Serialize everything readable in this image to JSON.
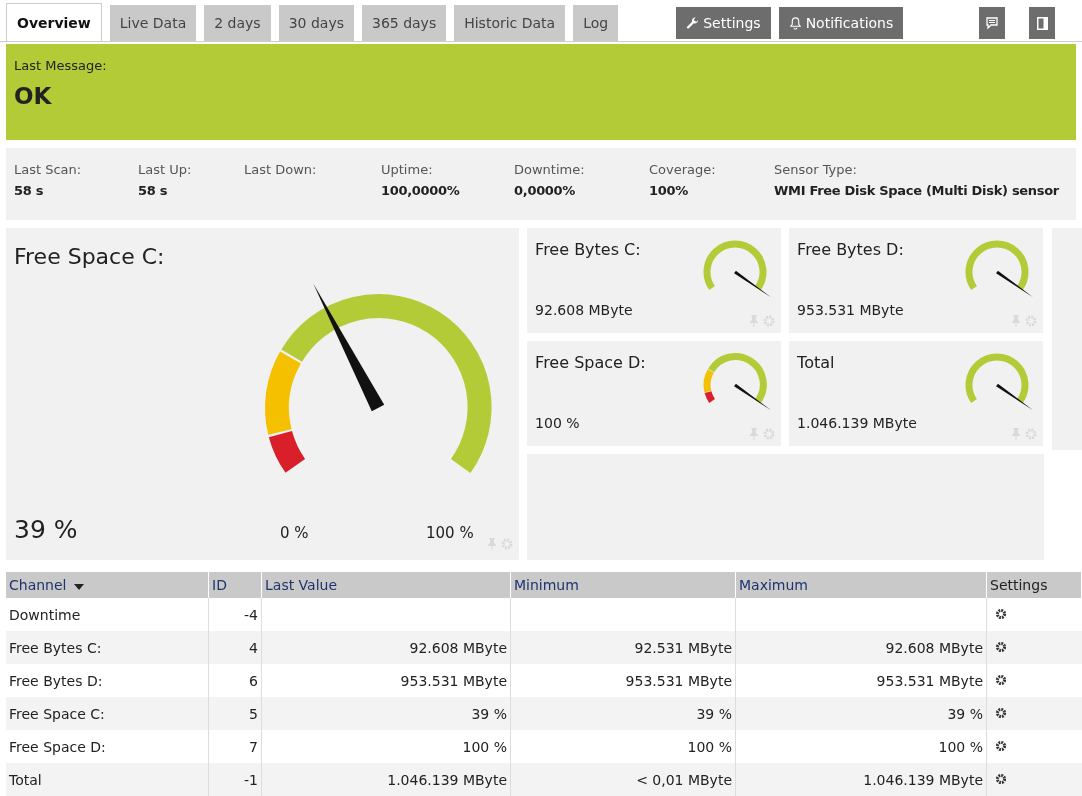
{
  "tabs": [
    {
      "label": "Overview",
      "selected": true
    },
    {
      "label": "Live Data",
      "selected": false
    },
    {
      "label": "2 days",
      "selected": false
    },
    {
      "label": "30 days",
      "selected": false
    },
    {
      "label": "365 days",
      "selected": false
    },
    {
      "label": "Historic Data",
      "selected": false
    },
    {
      "label": "Log",
      "selected": false
    }
  ],
  "actions": [
    {
      "label": "Settings",
      "kind": "wrench"
    },
    {
      "label": "Notifications",
      "kind": "bell"
    }
  ],
  "status": {
    "label": "Last Message:",
    "message": "OK"
  },
  "stats": [
    {
      "label": "Last Scan:",
      "value": "58 s"
    },
    {
      "label": "Last Up:",
      "value": "58 s"
    },
    {
      "label": "Last Down:"
    },
    {
      "label": "Uptime:",
      "value": "100,0000%"
    },
    {
      "label": "Downtime:",
      "value": "0,0000%"
    },
    {
      "label": "Coverage:",
      "value": "100%"
    },
    {
      "label": "Sensor Type:",
      "value": "WMI Free Disk Space (Multi Disk) sensor"
    }
  ],
  "main_gauge": {
    "title": "Free Space C:",
    "value": "39 %",
    "warning_zones": true,
    "min_label": "0 %",
    "max_label": "100 %"
  },
  "gauges": [
    {
      "title": "Free Bytes C:",
      "value": "92.608 MByte",
      "warning_zones": false
    },
    {
      "title": "Free Bytes D:",
      "value": "953.531 MByte",
      "warning_zones": false
    },
    {
      "title": "Free Space D:",
      "value": "100 %",
      "warning_zones": true
    },
    {
      "title": "Total",
      "value": "1.046.139 MByte",
      "warning_zones": false
    }
  ],
  "table": {
    "columns": [
      "Channel",
      "ID",
      "Last Value",
      "Minimum",
      "Maximum",
      "Settings"
    ],
    "rows": [
      [
        "Downtime",
        "-4",
        "",
        "",
        ""
      ],
      [
        "Free Bytes C:",
        "4",
        "92.608 MByte",
        "92.531 MByte",
        "92.608 MByte"
      ],
      [
        "Free Bytes D:",
        "6",
        "953.531 MByte",
        "953.531 MByte",
        "953.531 MByte"
      ],
      [
        "Free Space C:",
        "5",
        "39 %",
        "39 %",
        "39 %"
      ],
      [
        "Free Space D:",
        "7",
        "100 %",
        "100 %",
        "100 %"
      ],
      [
        "Total",
        "-1",
        "1.046.139 MByte",
        "< 0,01 MByte",
        "1.046.139 MByte"
      ]
    ]
  }
}
